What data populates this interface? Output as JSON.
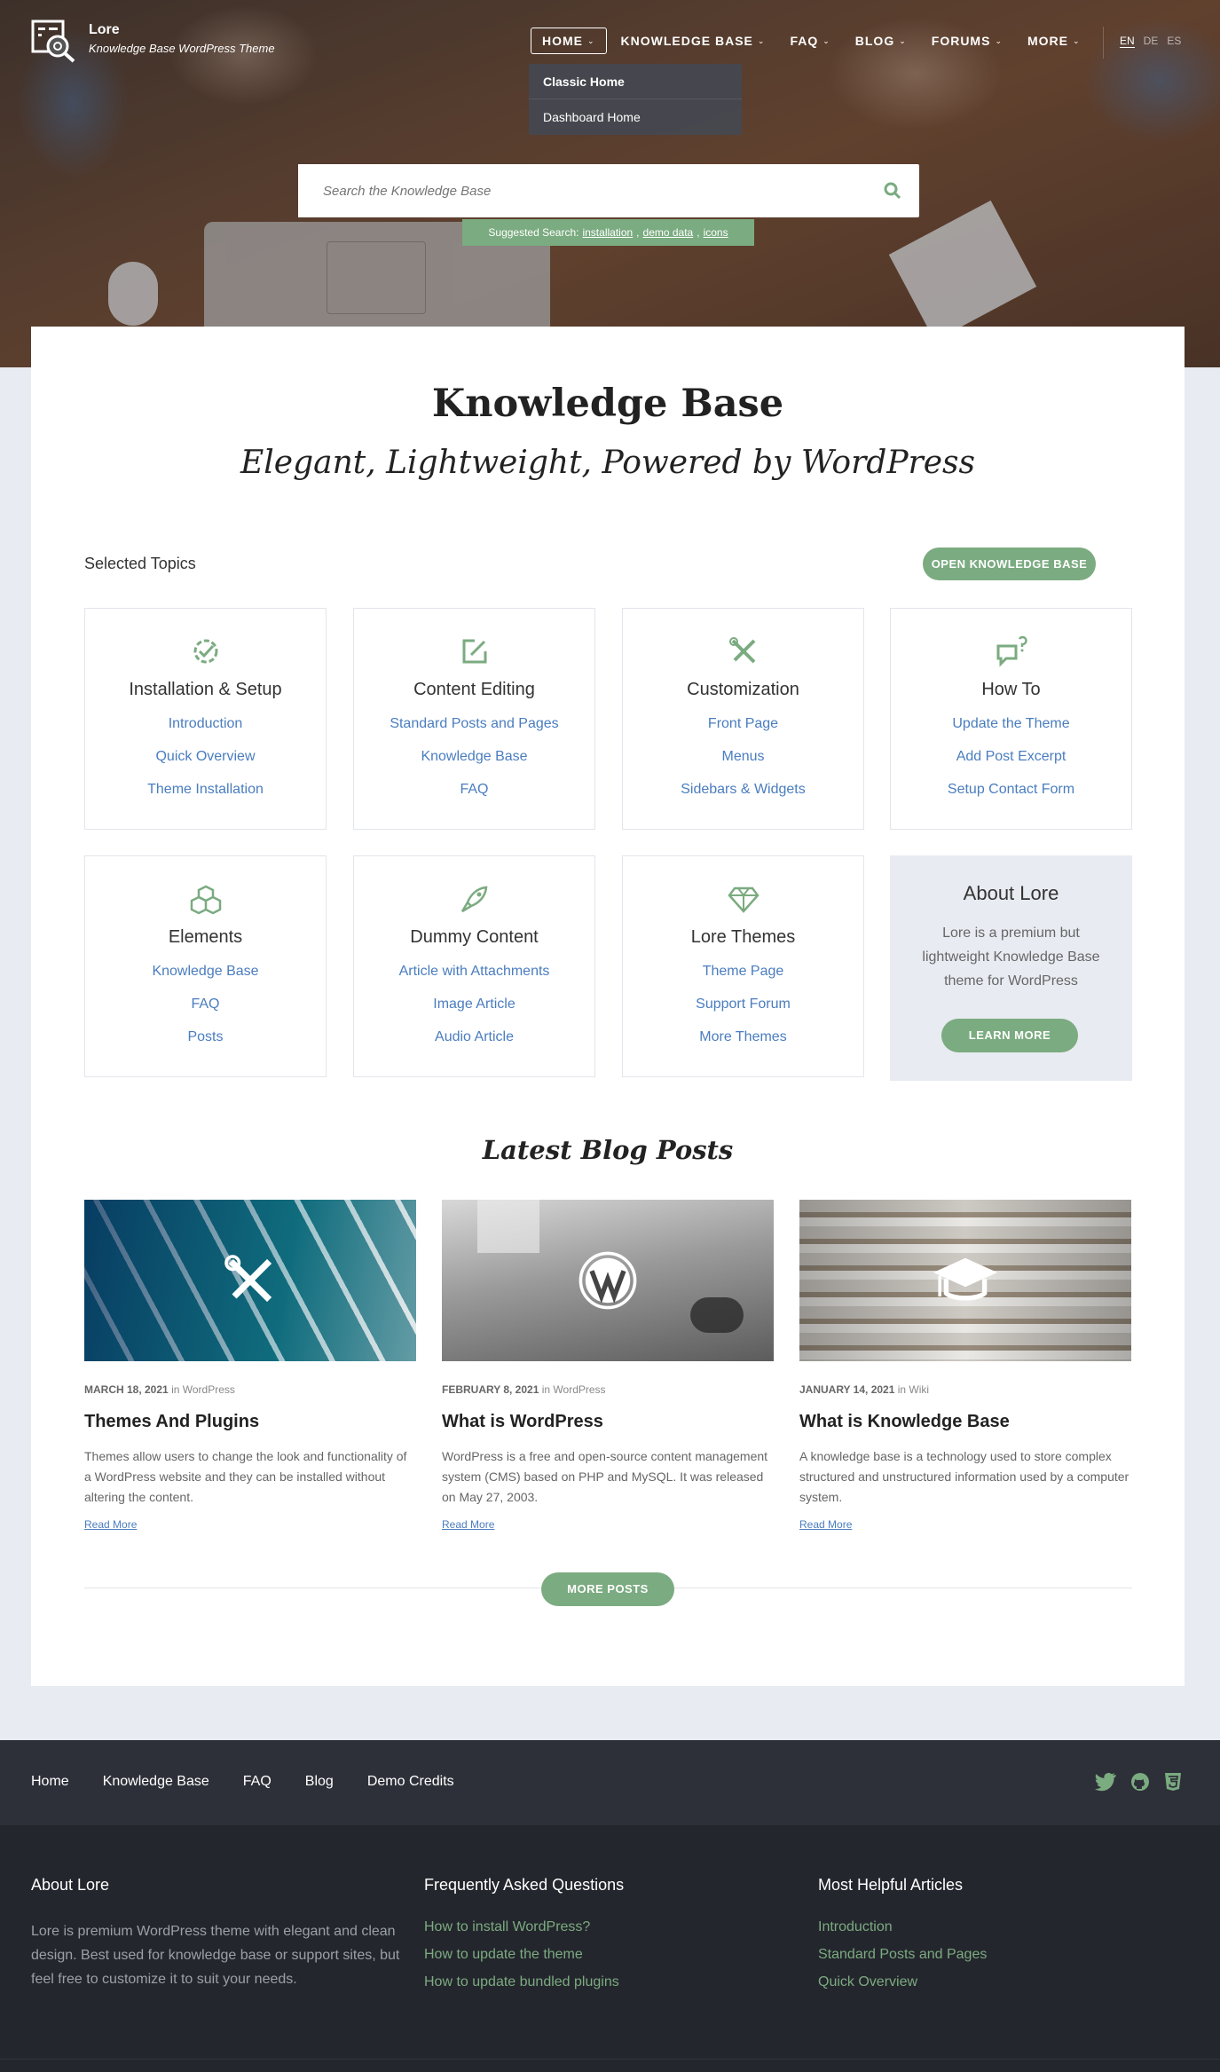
{
  "header": {
    "brand_name": "Lore",
    "brand_tagline": "Knowledge Base WordPress Theme",
    "nav": [
      {
        "label": "HOME"
      },
      {
        "label": "KNOWLEDGE BASE"
      },
      {
        "label": "FAQ"
      },
      {
        "label": "BLOG"
      },
      {
        "label": "FORUMS"
      },
      {
        "label": "MORE"
      }
    ],
    "languages": [
      "EN",
      "DE",
      "ES"
    ],
    "dropdown": [
      "Classic Home",
      "Dashboard Home"
    ]
  },
  "search": {
    "placeholder": "Search the Knowledge Base",
    "suggest_label": "Suggested Search:",
    "suggestions": [
      "installation",
      "demo data",
      "icons"
    ]
  },
  "kb": {
    "title": "Knowledge Base",
    "subtitle": "Elegant, Lightweight, Powered by WordPress",
    "selected_topics": "Selected Topics",
    "open_button": "OPEN KNOWLEDGE BASE"
  },
  "topics": [
    {
      "name": "Installation & Setup",
      "icon": "gear-check-icon",
      "links": [
        "Introduction",
        "Quick Overview",
        "Theme Installation"
      ]
    },
    {
      "name": "Content Editing",
      "icon": "edit-icon",
      "links": [
        "Standard Posts and Pages",
        "Knowledge Base",
        "FAQ"
      ]
    },
    {
      "name": "Customization",
      "icon": "tools-icon",
      "links": [
        "Front Page",
        "Menus",
        "Sidebars & Widgets"
      ]
    },
    {
      "name": "How To",
      "icon": "question-chat-icon",
      "links": [
        "Update the Theme",
        "Add Post Excerpt",
        "Setup Contact Form"
      ]
    },
    {
      "name": "Elements",
      "icon": "cubes-icon",
      "links": [
        "Knowledge Base",
        "FAQ",
        "Posts"
      ]
    },
    {
      "name": "Dummy Content",
      "icon": "rocket-icon",
      "links": [
        "Article with Attachments",
        "Image Article",
        "Audio Article"
      ]
    },
    {
      "name": "Lore Themes",
      "icon": "diamond-icon",
      "links": [
        "Theme Page",
        "Support Forum",
        "More Themes"
      ]
    }
  ],
  "about": {
    "title": "About Lore",
    "desc": "Lore is a premium but lightweight Knowledge Base theme for WordPress",
    "button": "LEARN MORE"
  },
  "blog": {
    "title": "Latest Blog Posts",
    "more_button": "MORE POSTS",
    "posts": [
      {
        "date": "MARCH 18, 2021",
        "in": "in",
        "category": "WordPress",
        "title": "Themes And Plugins",
        "excerpt": "Themes allow users to change the look and functionality of a WordPress website and they can be installed without altering the content.",
        "read_more": "Read More",
        "icon": "tools-icon"
      },
      {
        "date": "FEBRUARY 8, 2021",
        "in": "in",
        "category": "WordPress",
        "title": "What is WordPress",
        "excerpt": "WordPress is a free and open-source content management system (CMS) based on PHP and MySQL. It was released on May 27, 2003.",
        "read_more": "Read More",
        "icon": "wordpress-icon"
      },
      {
        "date": "JANUARY 14, 2021",
        "in": "in",
        "category": "Wiki",
        "title": "What is Knowledge Base",
        "excerpt": "A knowledge base is a technology used to store complex structured and unstructured information used by a computer system.",
        "read_more": "Read More",
        "icon": "graduation-cap-icon"
      }
    ]
  },
  "footer": {
    "links": [
      "Home",
      "Knowledge Base",
      "FAQ",
      "Blog",
      "Demo Credits"
    ],
    "social": [
      "twitter-icon",
      "github-icon",
      "html5-icon"
    ],
    "about_title": "About Lore",
    "about_text": "Lore is premium WordPress theme with elegant and clean design. Best used for knowledge base or support sites, but feel free to customize it to suit your needs.",
    "faq_title": "Frequently Asked Questions",
    "faq_links": [
      "How to install WordPress?",
      "How to update the theme",
      "How to update bundled plugins"
    ],
    "helpful_title": "Most Helpful Articles",
    "helpful_links": [
      "Introduction",
      "Standard Posts and Pages",
      "Quick Overview"
    ]
  },
  "colors": {
    "accent": "#7bab80",
    "link": "#4a7dbf",
    "footer_dark": "#24262d"
  }
}
